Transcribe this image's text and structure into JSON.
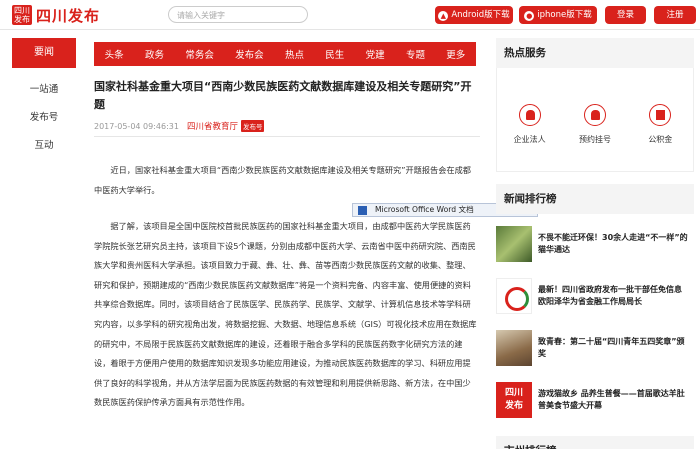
{
  "header": {
    "logo_mark": "四川\n发布",
    "logo_text": "四川发布",
    "search_placeholder": "请输入关键字",
    "android_label": "Android版下载",
    "iphone_label": "iphone版下载",
    "login_label": "登录",
    "register_label": "注册"
  },
  "leftnav": {
    "active": "要闻",
    "items": [
      "一站通",
      "发布号",
      "互动"
    ]
  },
  "channels": [
    "头条",
    "政务",
    "常务会",
    "发布会",
    "热点",
    "民生",
    "党建",
    "专题",
    "更多"
  ],
  "article": {
    "title": "国家社科基金重大项目“西南少数民族医药文献数据库建设及相关专题研究”开题",
    "date": "2017-05-04 09:46:31",
    "source": "四川省教育厅",
    "source_tag": "发布号",
    "p1": "近日，国家社科基金重大项目“西南少数民族医药文献数据库建设及相关专题研究”开题报告会在成都中医药大学举行。",
    "p2": "据了解，该项目是全国中医院校首批民族医药的国家社科基金重大项目，由成都中医药大学民族医药学院院长张艺研究员主持，该项目下设5个课题，分别由成都中医药大学、云南省中医中药研究院、西南民族大学和贵州医科大学承担。该项目致力于藏、彝、壮、彝、苗等西南少数民族医药文献的收集、整理、研究和保护，预期建成的“西南少数民族医药文献数据库”将是一个资料完备、内容丰富、使用便捷的资料共享综合数据库。同时，该项目结合了民族医学、民族药学、民族学、文献学、计算机信息技术等学科研究内容，以多学科的研究视角出发，将数据挖掘、大数据、地理信息系统（GIS）可视化技术应用在数据库的研究中，不局限于民族医药文献数据库的建设，还着眼于融合多学科的民族医药数字化研究方法的建设，着眼于方便用户使用的数据库知识发现多功能应用建设，为推动民族医药数据库的学习、科研应用提供了良好的科学视角，并从方法学层面为民族医药数据的有效管理和利用提供新思路、新方法，在中国少数民族医药保护传承方面具有示范性作用。"
  },
  "tooltip": "Microsoft Office Word 文档",
  "right": {
    "hot_services_title": "热点服务",
    "services": [
      "企业法人",
      "预约挂号",
      "公积金"
    ],
    "news_rank_title": "新闻排行榜",
    "news": [
      "不畏不能迁环保！30余人走进“不一样”的猫华通达",
      "最新！四川省政府发布一批干部任免信息 欧阳泽华为省金融工作局局长",
      "致青春：第二十届“四川青年五四奖章”颁奖",
      "游戏猫故乡 品养生普餐——首届歌达羊肚普美食节盛大开幕"
    ],
    "news_thumb4": "四川\n发布",
    "city_rank_title": "市州排行榜"
  },
  "colors": {
    "brand_red": "#d9221c"
  }
}
